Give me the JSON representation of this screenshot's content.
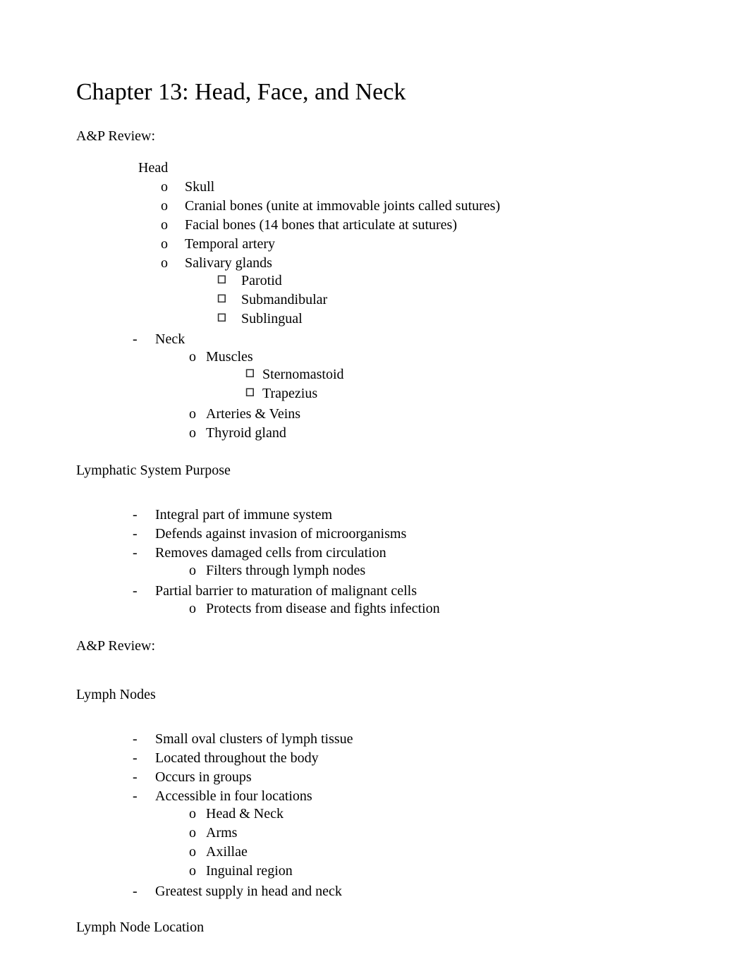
{
  "title": "Chapter 13: Head, Face, and Neck",
  "sections": {
    "ap_review_1": {
      "heading": "A&P Review:",
      "head_label": "Head",
      "head_items": {
        "skull": "Skull",
        "cranial": "Cranial bones (unite at immovable joints called sutures)",
        "facial": "Facial bones (14 bones that articulate at sutures)",
        "temporal": "Temporal artery",
        "salivary": "Salivary glands",
        "salivary_sub": {
          "parotid": "Parotid",
          "submandibular": "Submandibular",
          "sublingual": "Sublingual"
        }
      },
      "neck_label": "Neck",
      "neck_items": {
        "muscles": "Muscles",
        "muscles_sub": {
          "sternomastoid": "Sternomastoid",
          "trapezius": "Trapezius"
        },
        "arteries": "Arteries & Veins",
        "thyroid": "Thyroid gland"
      }
    },
    "lymph_purpose": {
      "heading": "Lymphatic System Purpose",
      "items": {
        "integral": "Integral part of immune system",
        "defends": "Defends against invasion of microorganisms",
        "removes": "Removes damaged cells from circulation",
        "removes_sub": {
          "filters": "Filters through lymph nodes"
        },
        "partial": "Partial barrier to maturation of malignant cells",
        "partial_sub": {
          "protects": "Protects from disease and fights infection"
        }
      }
    },
    "ap_review_2": {
      "heading": "A&P Review:"
    },
    "lymph_nodes": {
      "heading": "Lymph Nodes",
      "items": {
        "small": "Small oval clusters of lymph tissue",
        "located": "Located throughout the body",
        "occurs": "Occurs in groups",
        "accessible": "Accessible in four locations",
        "accessible_sub": {
          "head_neck": "Head & Neck",
          "arms": "Arms",
          "axillae": "Axillae",
          "inguinal": "Inguinal region"
        },
        "greatest": "Greatest supply in head and neck"
      }
    },
    "lymph_location": {
      "heading": "Lymph Node Location"
    }
  },
  "markers": {
    "dash": "-",
    "circle": "o",
    "square": "🞑"
  }
}
